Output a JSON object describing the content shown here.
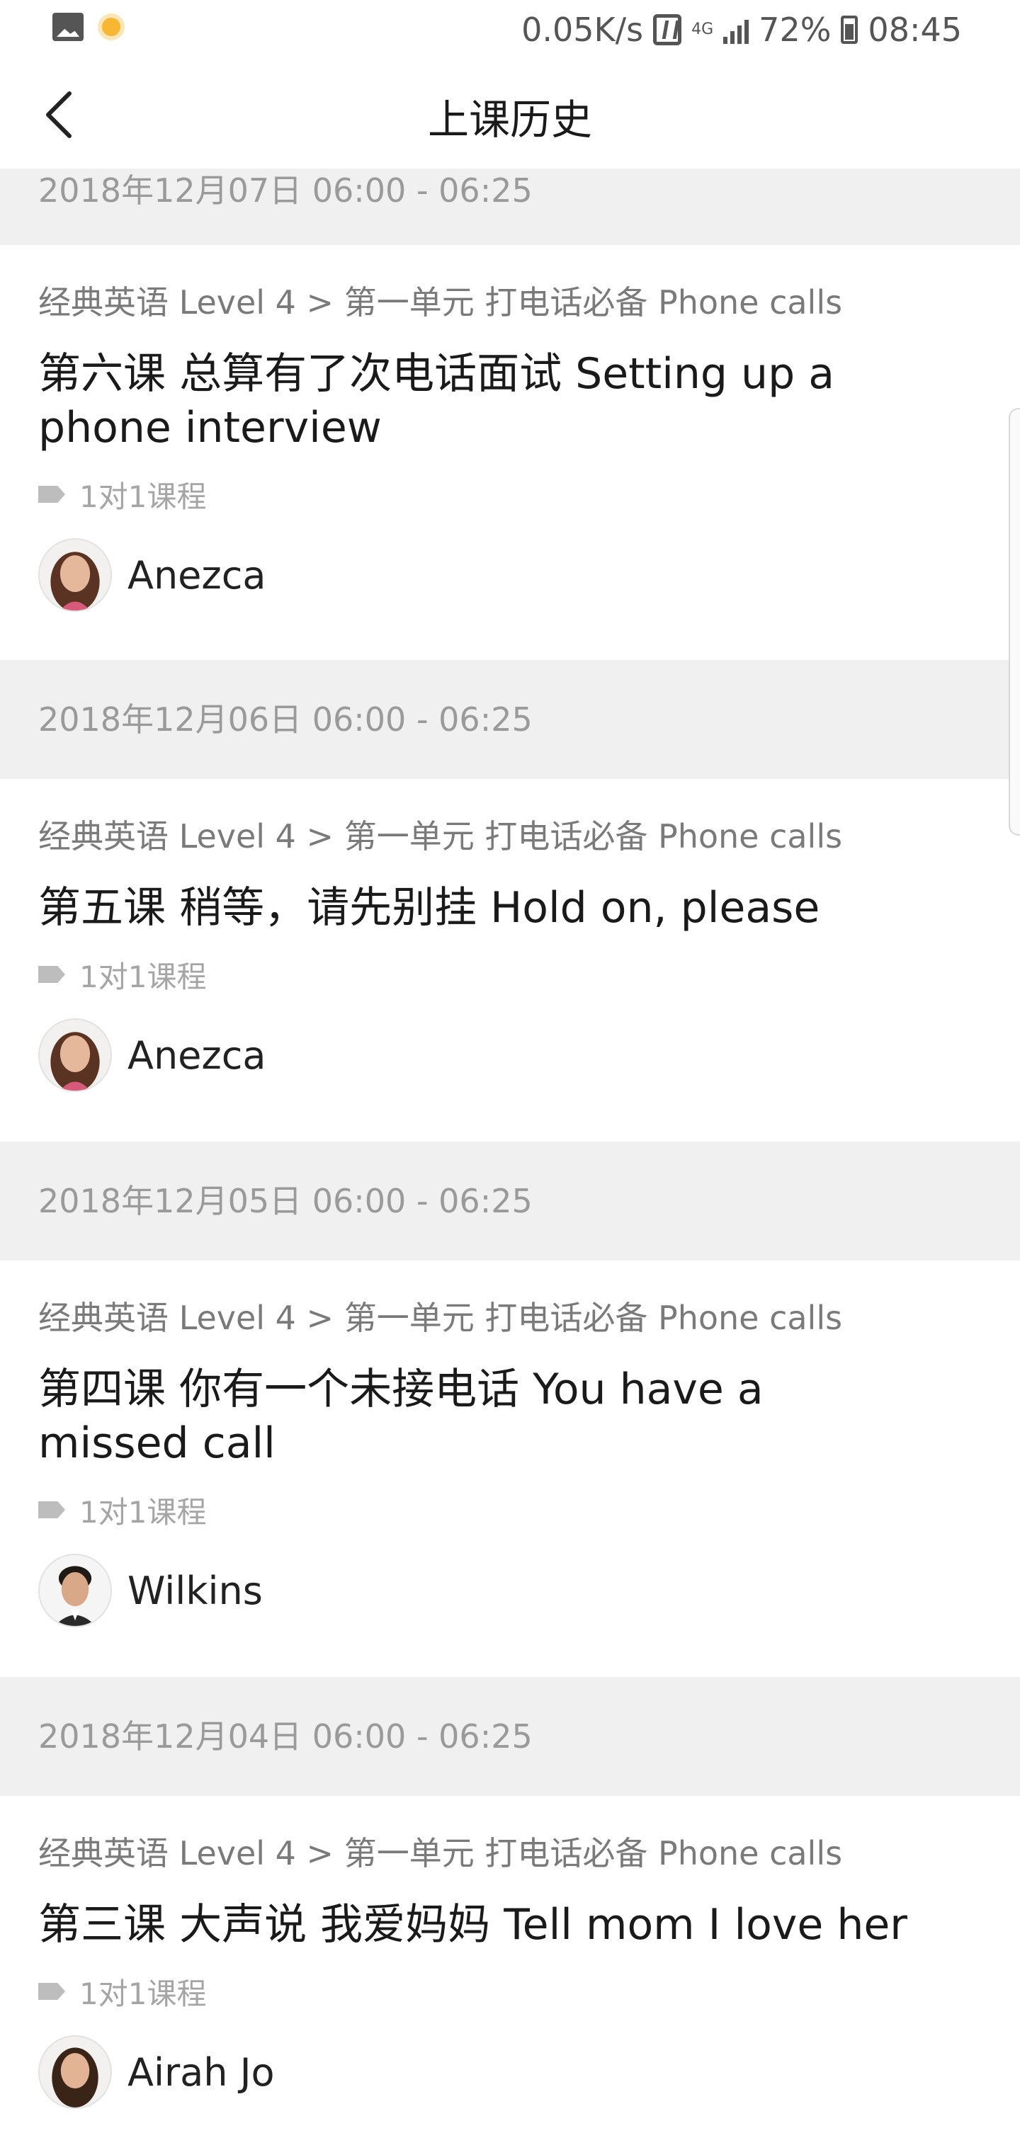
{
  "status_bar": {
    "speed": "0.05K/s",
    "network": "4G",
    "battery": "72%",
    "time": "08:45"
  },
  "header": {
    "title": "上课历史"
  },
  "sessions": [
    {
      "date": "2018年12月07日 06:00 - 06:25",
      "breadcrumb": "经典英语 Level 4 > 第一单元 打电话必备 Phone calls",
      "lesson": "第六课 总算有了次电话面试 Setting up a phone interview",
      "tag": "1对1课程",
      "teacher": "Anezca"
    },
    {
      "date": "2018年12月06日 06:00 - 06:25",
      "breadcrumb": "经典英语 Level 4 > 第一单元 打电话必备 Phone calls",
      "lesson": "第五课 稍等，请先别挂 Hold on, please",
      "tag": "1对1课程",
      "teacher": "Anezca"
    },
    {
      "date": "2018年12月05日 06:00 - 06:25",
      "breadcrumb": "经典英语 Level 4 > 第一单元 打电话必备 Phone calls",
      "lesson": "第四课 你有一个未接电话 You have a missed call",
      "tag": "1对1课程",
      "teacher": "Wilkins"
    },
    {
      "date": "2018年12月04日 06:00 - 06:25",
      "breadcrumb": "经典英语 Level 4 > 第一单元 打电话必备 Phone calls",
      "lesson": "第三课 大声说 我爱妈妈 Tell mom I love her",
      "tag": "1对1课程",
      "teacher": "Airah Jo"
    }
  ]
}
